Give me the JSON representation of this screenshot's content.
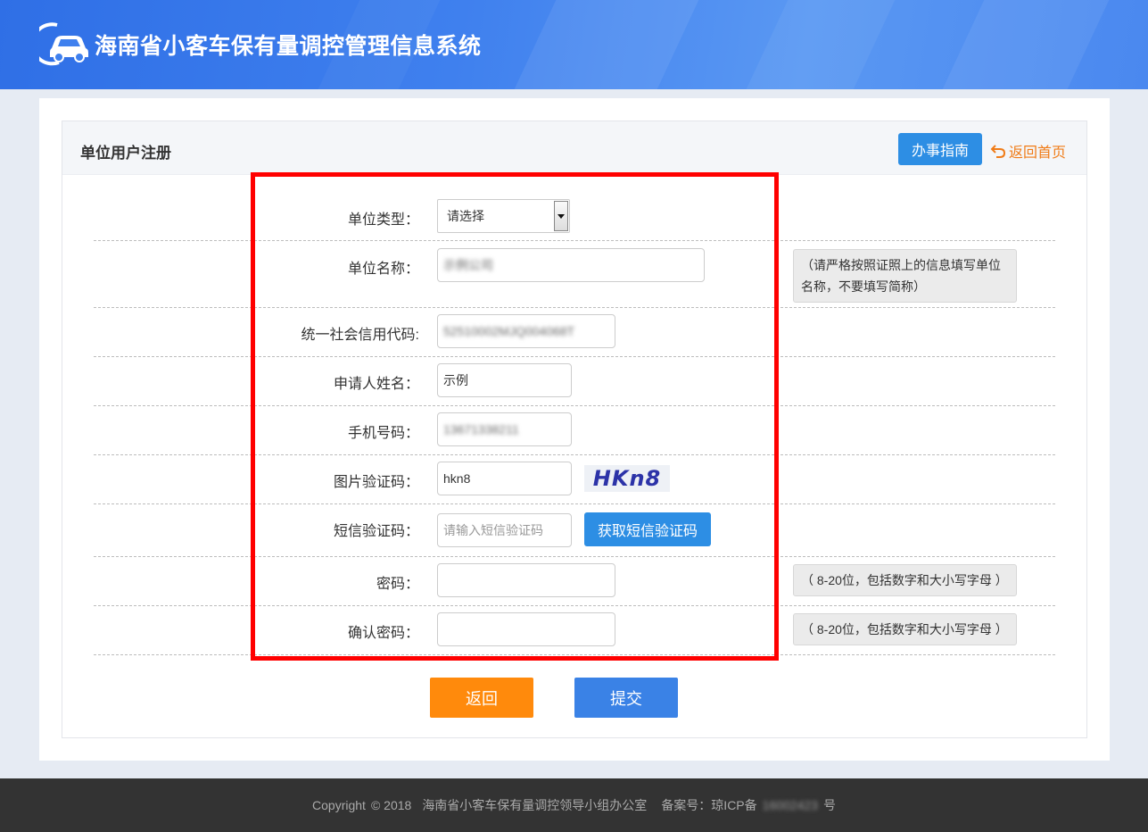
{
  "header": {
    "site_title": "海南省小客车保有量调控管理信息系统",
    "logo_icon": "car-logo-icon"
  },
  "panel": {
    "title": "单位用户注册",
    "guide_label": "办事指南",
    "home_label": "返回首页"
  },
  "form": {
    "unit_type": {
      "label": "单位类型：",
      "selected": "请选择"
    },
    "unit_name": {
      "label": "单位名称：",
      "value": "示例公司",
      "tip": "（请严格按照证照上的信息填写单位名称，不要填写简称）"
    },
    "credit_code": {
      "label": "统一社会信用代码:",
      "value": "52510002MJQ004068T"
    },
    "applicant_name": {
      "label": "申请人姓名：",
      "value": "示例"
    },
    "phone": {
      "label": "手机号码：",
      "value": "13671338211"
    },
    "image_captcha": {
      "label": "图片验证码：",
      "value": "hkn8",
      "captcha_text": "HKn8"
    },
    "sms_code": {
      "label": "短信验证码：",
      "placeholder": "请输入短信验证码",
      "button_label": "获取短信验证码"
    },
    "password": {
      "label": "密码：",
      "tip": "（ 8-20位，包括数字和大小写字母 ）"
    },
    "confirm_password": {
      "label": "确认密码：",
      "tip": "（ 8-20位，包括数字和大小写字母 ）"
    }
  },
  "actions": {
    "back_label": "返回",
    "submit_label": "提交"
  },
  "footer": {
    "copyright": "Copyright",
    "year": "© 2018",
    "org": "海南省小客车保有量调控领导小组办公室",
    "icp_prefix": "备案号：琼ICP备",
    "icp_number": "16002423",
    "icp_suffix": "号"
  },
  "colors": {
    "primary": "#2d8ee4",
    "back_button": "#ff8a0c",
    "submit_button": "#3a82e6",
    "highlight_box": "#ff0000",
    "home_link": "#f07c18"
  }
}
